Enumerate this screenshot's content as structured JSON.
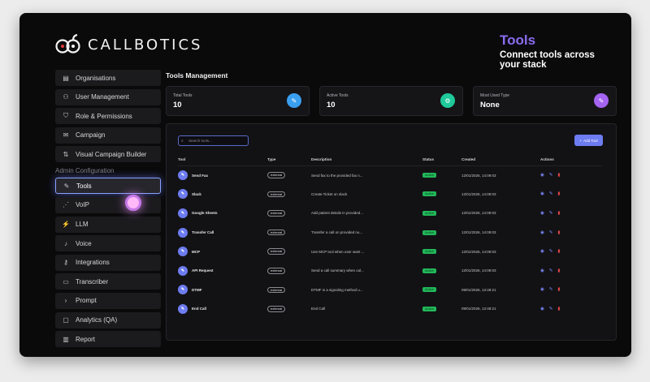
{
  "brand": {
    "name": "CALLBOTICS"
  },
  "promo": {
    "title": "Tools",
    "subtitle": "Connect tools across your stack"
  },
  "sidebar": {
    "top_items": [
      {
        "label": "Organisations",
        "icon": "building-icon"
      },
      {
        "label": "User Management",
        "icon": "users-icon"
      },
      {
        "label": "Role & Permissions",
        "icon": "shield-icon"
      },
      {
        "label": "Campaign",
        "icon": "inbox-icon"
      },
      {
        "label": "Visual Campaign Builder",
        "icon": "flow-icon"
      }
    ],
    "section_label": "Admin Configuration",
    "admin_items": [
      {
        "label": "Tools",
        "icon": "wrench-icon",
        "active": true
      },
      {
        "label": "VoIP",
        "icon": "signal-icon"
      },
      {
        "label": "LLM",
        "icon": "bolt-icon"
      },
      {
        "label": "Voice",
        "icon": "mic-icon"
      },
      {
        "label": "Integrations",
        "icon": "key-icon"
      },
      {
        "label": "Transcriber",
        "icon": "document-icon"
      },
      {
        "label": "Prompt",
        "icon": "terminal-icon"
      },
      {
        "label": "Analytics (QA)",
        "icon": "monitor-icon"
      },
      {
        "label": "Report",
        "icon": "report-icon"
      }
    ]
  },
  "main": {
    "title": "Tools Management",
    "stats": [
      {
        "label": "Total Tools",
        "value": "10",
        "icon": "wrench-icon",
        "color": "#3b9ff0"
      },
      {
        "label": "Active Tools",
        "value": "10",
        "icon": "gear-icon",
        "color": "#1fc99a"
      },
      {
        "label": "Most Used Type",
        "value": "None",
        "icon": "wrench-icon",
        "color": "#a463f0"
      }
    ],
    "search_placeholder": "Search tools...",
    "add_button": "Add Tool",
    "columns": [
      "Tool",
      "Type",
      "Description",
      "Status",
      "Created",
      "Actions"
    ],
    "rows": [
      {
        "tool": "Send Fax",
        "type": "external",
        "description": "Send fax to the provided fax n...",
        "status": "Active",
        "created": "12/01/2026, 14:09:03"
      },
      {
        "tool": "Slack",
        "type": "external",
        "description": "Create Ticket on slack",
        "status": "Active",
        "created": "12/01/2026, 14:09:03"
      },
      {
        "tool": "Google Sheets",
        "type": "external",
        "description": "Add patient details in provided...",
        "status": "Active",
        "created": "12/01/2026, 14:09:03"
      },
      {
        "tool": "Transfer Call",
        "type": "external",
        "description": "Transfer a call on provided nu...",
        "status": "Active",
        "created": "12/01/2026, 14:09:03"
      },
      {
        "tool": "MCP",
        "type": "external",
        "description": "Use MCP tool when user want ...",
        "status": "Active",
        "created": "12/01/2026, 14:09:03"
      },
      {
        "tool": "API Request",
        "type": "external",
        "description": "Send a call summary when cal...",
        "status": "Active",
        "created": "12/01/2026, 14:09:03"
      },
      {
        "tool": "DTMF",
        "type": "external",
        "description": "DTMF is a signaling method u...",
        "status": "Active",
        "created": "09/01/2026, 13:48:21"
      },
      {
        "tool": "End Call",
        "type": "external",
        "description": "End Call",
        "status": "Active",
        "created": "09/01/2026, 13:48:21"
      }
    ]
  }
}
